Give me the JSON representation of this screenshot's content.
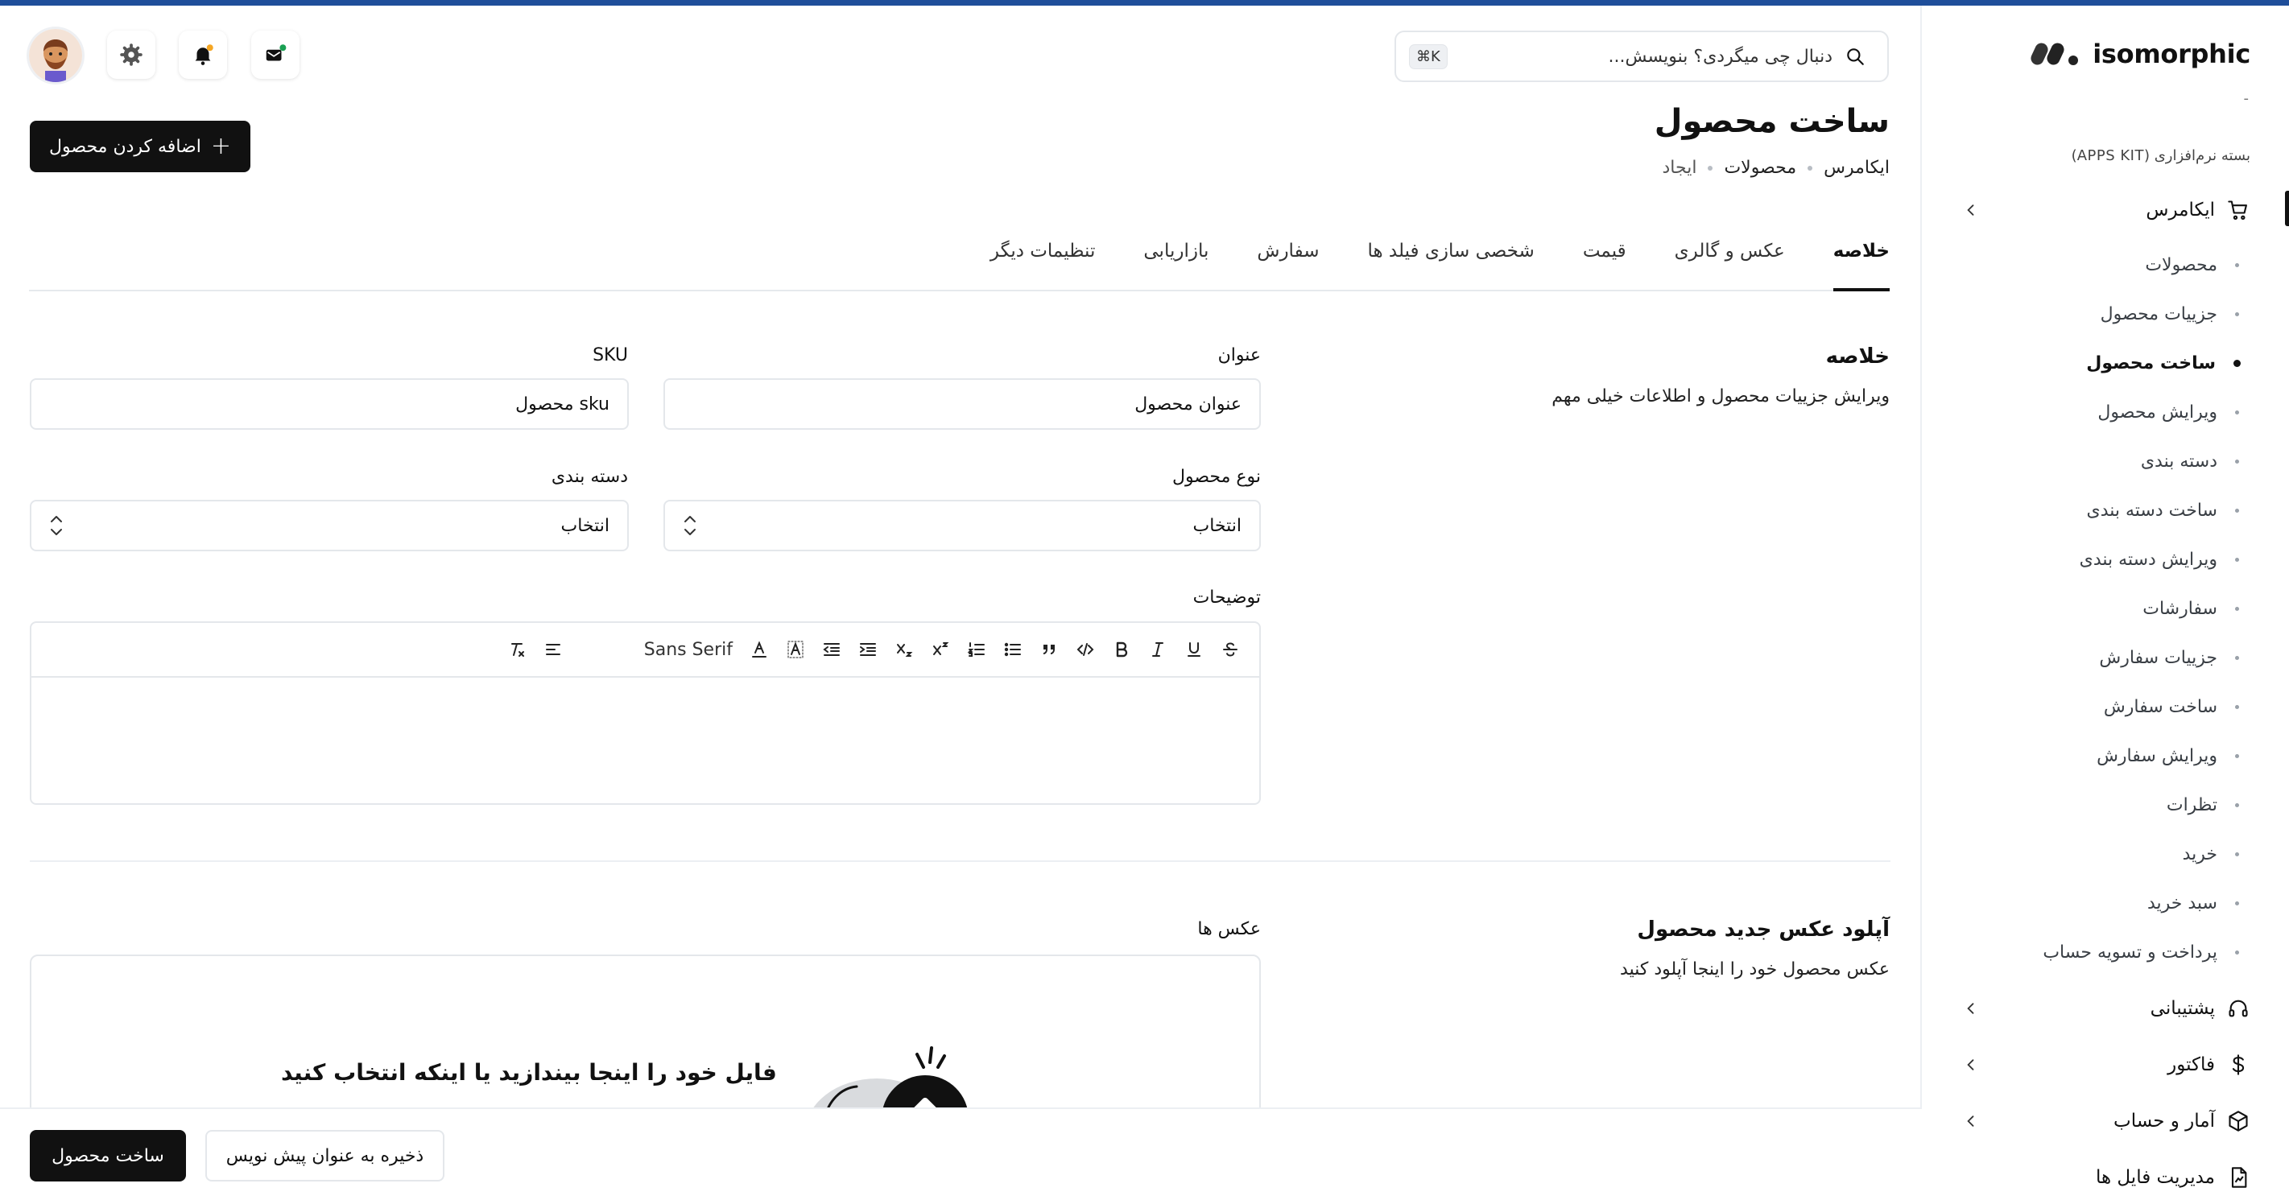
{
  "brand": {
    "name": "isomorphic"
  },
  "sidebar": {
    "scroll_mark": "-",
    "section_label": "بسته نرم‌افزاری (APPS KIT)",
    "ecommerce": {
      "label": "ایکامرس",
      "items": [
        {
          "label": "محصولات"
        },
        {
          "label": "جزییات محصول"
        },
        {
          "label": "ساخت محصول",
          "active": true
        },
        {
          "label": "ویرایش محصول"
        },
        {
          "label": "دسته بندی"
        },
        {
          "label": "ساخت دسته بندی"
        },
        {
          "label": "ویرایش دسته بندی"
        },
        {
          "label": "سفارشات"
        },
        {
          "label": "جزییات سفارش"
        },
        {
          "label": "ساخت سفارش"
        },
        {
          "label": "ویرایش سفارش"
        },
        {
          "label": "تظرات"
        },
        {
          "label": "خرید"
        },
        {
          "label": "سبد خرید"
        },
        {
          "label": "پرداخت و تسویه حساب"
        }
      ]
    },
    "groups": [
      {
        "label": "پشتیبانی",
        "icon": "headset-icon"
      },
      {
        "label": "فاکتور",
        "icon": "dollar-icon"
      },
      {
        "label": "آمار و حساب",
        "icon": "cube-icon"
      },
      {
        "label": "مدیریت فایل ها",
        "icon": "file-chart-icon"
      }
    ]
  },
  "header": {
    "search_placeholder": "دنبال چی میگردی؟ بنویسش...",
    "search_shortcut": "⌘K",
    "icons": [
      "avatar",
      "gear-icon",
      "bell-icon",
      "message-icon"
    ],
    "colors": {
      "bell_badge": "#f5a623",
      "message_badge": "#1aa053"
    }
  },
  "page": {
    "title": "ساخت محصول",
    "breadcrumb": [
      "ایکامرس",
      "محصولات",
      "ایجاد"
    ],
    "add_button": "اضافه کردن محصول"
  },
  "tabs": [
    "خلاصه",
    "عکس و گالری",
    "قیمت",
    "شخصی سازی فیلد ها",
    "سفارش",
    "بازاریابی",
    "تنظیمات دیگر"
  ],
  "active_tab": "خلاصه",
  "summary": {
    "title": "خلاصه",
    "description": "ویرایش جزییات محصول و اطلاعات خیلی مهم",
    "fields": {
      "title_label": "عنوان",
      "title_placeholder": "عنوان محصول",
      "sku_label": "SKU",
      "sku_placeholder": "sku محصول",
      "type_label": "نوع محصول",
      "type_value": "انتخاب",
      "category_label": "دسته بندی",
      "category_value": "انتخاب",
      "description_label": "توضیحات"
    },
    "editor_font": "Sans Serif"
  },
  "upload": {
    "title": "آپلود عکس جدید محصول",
    "description": "عکس محصول خود را اینجا آپلود کنید",
    "images_label": "عکس ها",
    "dropzone_text": "فایل خود را اینجا بیندازید یا اینکه انتخاب کنید"
  },
  "footer": {
    "create_button": "ساخت محصول",
    "draft_button": "ذخیره به عنوان پیش نویس"
  },
  "colors": {
    "accent_bar": "#1f4e9a",
    "primary": "#111111"
  }
}
